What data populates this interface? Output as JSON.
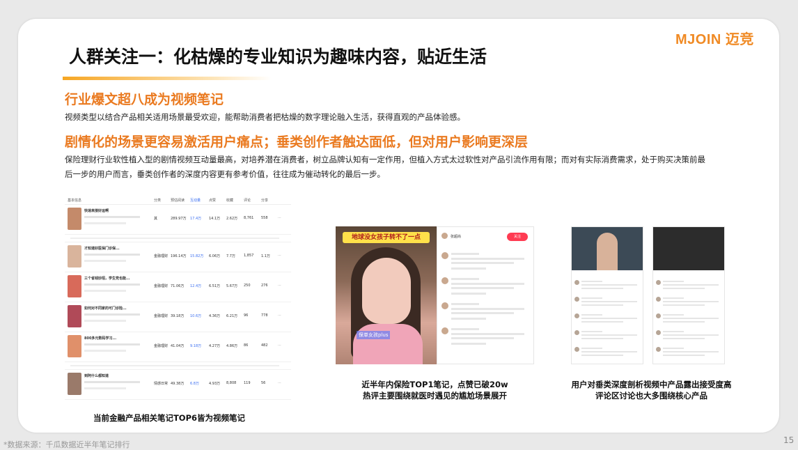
{
  "logo": "MJOIN 迈竞",
  "title": "人群关注一：化枯燥的专业知识为趣味内容，贴近生活",
  "section1": {
    "heading": "行业爆文超八成为视频笔记",
    "body": "视频类型以结合产品相关适用场景最受欢迎，能帮助消费者把枯燥的数字理论融入生活，获得直观的产品体验感。"
  },
  "section2": {
    "heading": "剧情化的场景更容易激活用户痛点；垂类创作者触达面低，但对用户影响更深层",
    "body_line1": "保险理财行业软性植入型的剧情视频互动量最高，对培养潜在消费者，树立品牌认知有一定作用，但植入方式太过软性对产品引流作用有限；而对有实际消费需求，处于购买决策前最",
    "body_line2": "后一步的用户而言，垂类创作者的深度内容更有参考价值，往往成为催动转化的最后一步。"
  },
  "table": {
    "headers": [
      "基本信息",
      "分类",
      "预估阅读",
      "互动量",
      "点赞",
      "收藏",
      "评论",
      "分享"
    ],
    "rows": [
      {
        "title": "快速来接好运啊",
        "cat": "其",
        "read": "289.97万",
        "inter": "17.4万",
        "like": "14.1万",
        "fav": "2.62万",
        "cmt": "8,761",
        "share": "558",
        "thumb": "#c48a6a"
      },
      {
        "title": "才知道好医保门诊保...",
        "cat": "金融理财",
        "read": "196.14万",
        "inter": "15.82万",
        "like": "6.06万",
        "fav": "7.7万",
        "cmt": "1,857",
        "share": "1.1万",
        "thumb": "#d9b49c"
      },
      {
        "title": "三个省钱妙招，学生党也能...",
        "cat": "金融理财",
        "read": "71.06万",
        "inter": "12.4万",
        "like": "6.51万",
        "fav": "5.67万",
        "cmt": "250",
        "share": "276",
        "thumb": "#d86a5a"
      },
      {
        "title": "如何对不同家的可门诊险...",
        "cat": "金融理财",
        "read": "39.18万",
        "inter": "10.6万",
        "like": "4.36万",
        "fav": "6.21万",
        "cmt": "96",
        "share": "778",
        "thumb": "#b04a58"
      },
      {
        "title": "800多元数码学习...",
        "cat": "金融理财",
        "read": "41.04万",
        "inter": "9.18万",
        "like": "4.27万",
        "fav": "4.86万",
        "cmt": "86",
        "share": "482",
        "thumb": "#e0906a"
      },
      {
        "title": "到阿什么都知道",
        "cat": "情感日常",
        "read": "49.38万",
        "inter": "6.8万",
        "like": "4.93万",
        "fav": "8,808",
        "cmt": "119",
        "share": "56",
        "thumb": "#9a7a6a"
      }
    ]
  },
  "caption_table": "当前金融产品相关笔记TOP6皆为视频笔记",
  "phone_a": {
    "banner": "地球没女孩子转不了一点",
    "sub": "保单女孩plus"
  },
  "phone_b": {
    "follow": "关注",
    "name": "张超尚"
  },
  "caption_video_line1": "近半年内保险TOP1笔记，点赞已破20w",
  "caption_video_line2": "热评主要围绕就医时遇见的尴尬场景展开",
  "caption_vertical_line1": "用户对垂类深度剖析视频中产品露出接受度高",
  "caption_vertical_line2": "评论区讨论也大多围绕核心产品",
  "footer_source": "*数据来源：千瓜数据近半年笔记排行",
  "page_number": "15"
}
